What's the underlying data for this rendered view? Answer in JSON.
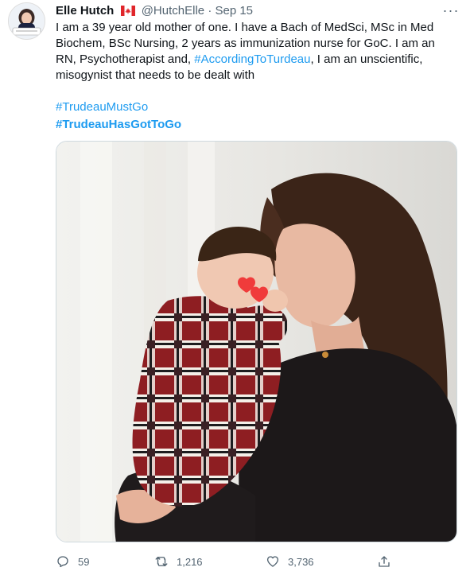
{
  "tweet": {
    "author": {
      "name": "Elle Hutch",
      "flag": "canada-flag",
      "handle": "@HutchElle",
      "separator": "·",
      "date": "Sep 15",
      "avatar_icon": "avatar-woman-icon"
    },
    "more_icon": "more-icon",
    "more_label": "···",
    "text_part1": "I am a 39 year old mother of one. I have a Bach of MedSci, MSc in Med Biochem, BSc Nursing, 2 years as immunization nurse for GoC. I am an RN, Psychotherapist and, ",
    "text_hashtag": "#AccordingToTurdeau",
    "text_part2": ", I am an unscientific, misogynist that needs to be dealt with",
    "hashtags": [
      "#TrudeauMustGo",
      "#TrudeauHasGotToGo"
    ],
    "media_description_icon": "photo-icon",
    "actions": {
      "reply_count": "59",
      "retweet_count": "1,216",
      "like_count": "3,736"
    },
    "colors": {
      "link": "#1d9bf0",
      "secondary": "#536471",
      "text": "#0f1419",
      "border": "#cfd9de"
    }
  }
}
